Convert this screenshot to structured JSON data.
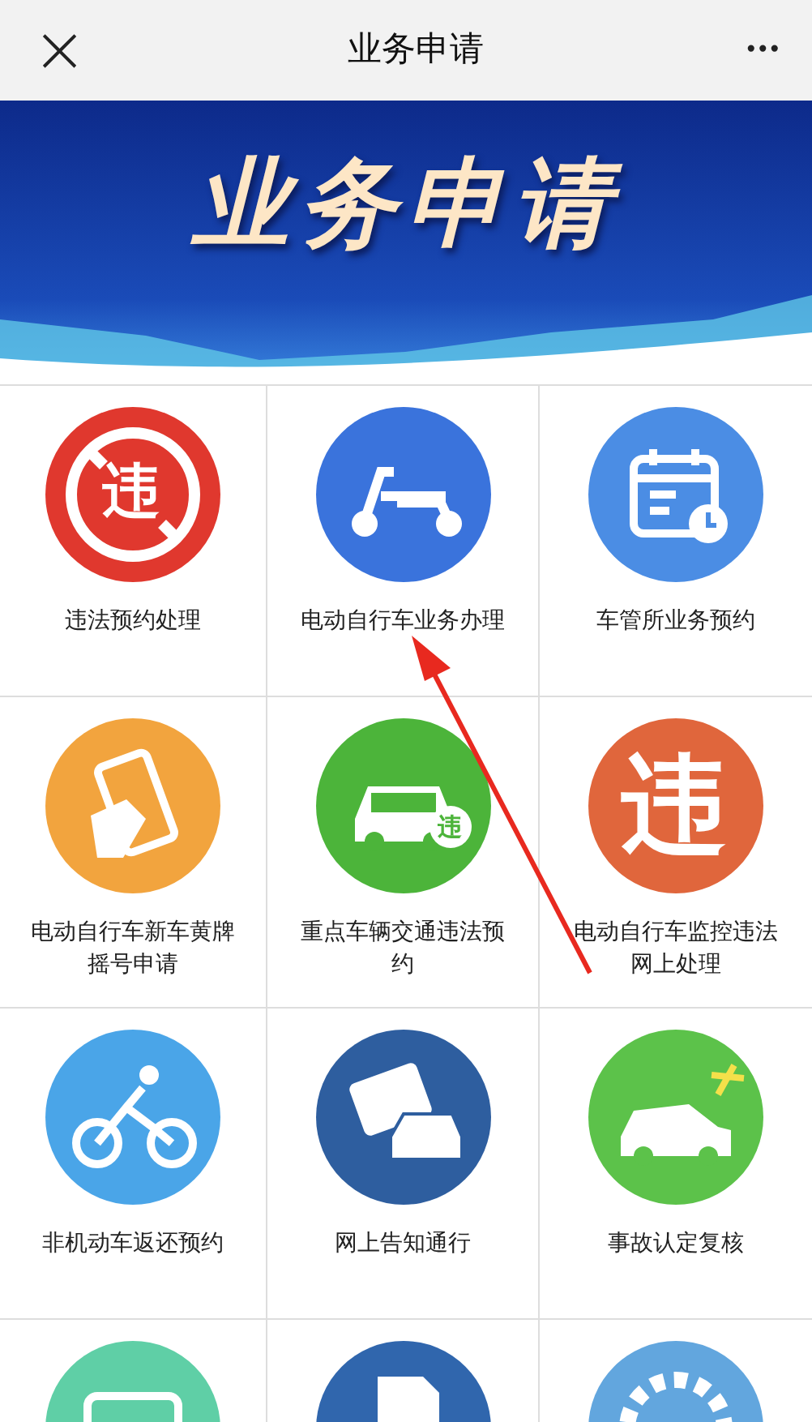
{
  "header": {
    "close_icon": "×",
    "title": "业务申请",
    "more": "•••"
  },
  "banner": {
    "title": "业务申请"
  },
  "services": [
    {
      "label": "违法预约处理",
      "kind": "prohibit",
      "glyph": "违",
      "color": "#e0382e"
    },
    {
      "label": "电动自行车业务办理",
      "kind": "scooter",
      "color": "#3a73dc"
    },
    {
      "label": "车管所业务预约",
      "kind": "calendar",
      "color": "#4b8de4"
    },
    {
      "label": "电动自行车新车黄牌摇号申请",
      "kind": "phone",
      "color": "#f2a43e"
    },
    {
      "label": "重点车辆交通违法预约",
      "kind": "carbadge",
      "glyph": "违",
      "color": "#4cb43a"
    },
    {
      "label": "电动自行车监控违法网上处理",
      "kind": "bigglyph",
      "glyph": "违",
      "color": "#e0663c"
    },
    {
      "label": "非机动车返还预约",
      "kind": "bicycle",
      "color": "#4aa5e8"
    },
    {
      "label": "网上告知通行",
      "kind": "cardcar",
      "color": "#2e5e9f"
    },
    {
      "label": "事故认定复核",
      "kind": "crash",
      "color": "#5cc24a"
    },
    {
      "kind": "card",
      "color": "#5fcfa6"
    },
    {
      "kind": "docs",
      "color": "#3066ad"
    },
    {
      "kind": "gear",
      "color": "#62a6de"
    }
  ]
}
